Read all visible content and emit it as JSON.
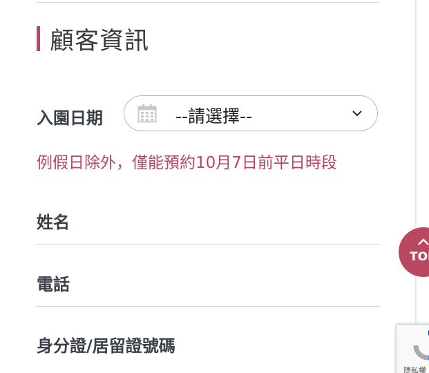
{
  "section": {
    "title": "顧客資訊"
  },
  "form": {
    "visit_date": {
      "label": "入園日期",
      "selected": "--請選擇--",
      "icon": "calendar-icon",
      "dropdown_icon": "chevron-down-icon"
    },
    "visit_note": "例假日除外，僅能預約10月7日前平日時段",
    "name": {
      "label": "姓名"
    },
    "phone": {
      "label": "電話"
    },
    "id_number": {
      "label": "身分證/居留證號碼"
    }
  },
  "back_to_top": {
    "label": "TOP",
    "icon": "chevron-up-icon"
  },
  "recaptcha": {
    "text": "隱私權"
  },
  "colors": {
    "accent": "#b8475f",
    "label": "#3a4048",
    "rule": "#cfcfcf"
  }
}
